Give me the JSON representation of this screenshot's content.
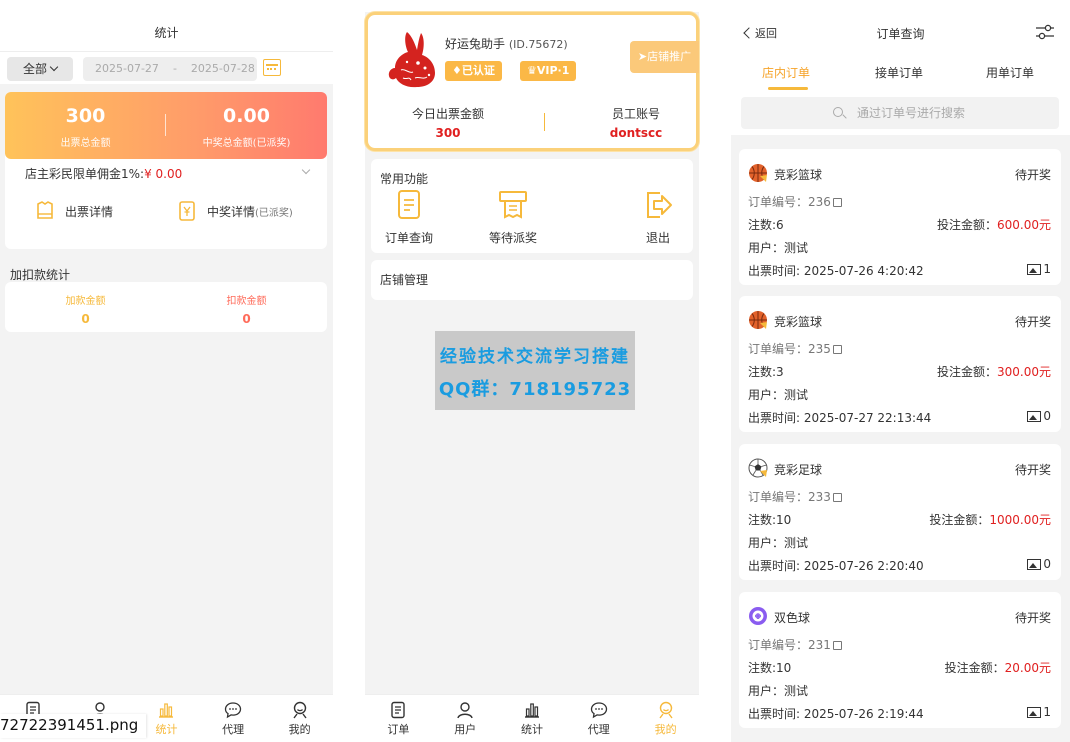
{
  "stats_panel": {
    "header_title": "统计",
    "scope_select": "全部",
    "date_start": "2025-07-27",
    "date_sep": "-",
    "date_end": "2025-07-28",
    "total_issue_value": "300",
    "total_issue_label": "出票总金额",
    "total_win_value": "0.00",
    "total_win_label": "中奖总金额(已派奖)",
    "commission_text": "店主彩民限单佣金1%:",
    "commission_amount": "¥ 0.00",
    "link_issue_detail": "出票详情",
    "link_win_detail": "中奖详情",
    "link_win_detail_sub": "(已派奖)",
    "adjust_section_title": "加扣款统计",
    "add_amount_label": "加款金额",
    "add_amount_value": "0",
    "deduct_amount_label": "扣款金额",
    "deduct_amount_value": "0",
    "tabs": [
      "订单",
      "用户",
      "统计",
      "代理",
      "我的"
    ],
    "active_tab": "统计",
    "accent_color": "#f6b93b"
  },
  "filename_overlay": "72722391451.png",
  "home_panel": {
    "shop_name": "好运兔助手",
    "shop_id": "(ID.75672)",
    "badge_verified": "已认证",
    "badge_vip": "VIP·1",
    "promo_button": "店铺推广",
    "today_issue_label": "今日出票金额",
    "today_issue_value": "300",
    "staff_account_label": "员工账号",
    "staff_account_value": "dontscc",
    "common_functions_title": "常用功能",
    "functions": [
      "订单查询",
      "等待派奖",
      "退出"
    ],
    "shop_manage": "店铺管理",
    "watermark_line1": "经验技术交流学习搭建",
    "watermark_line2": "QQ群：718195723",
    "tabs": [
      "订单",
      "用户",
      "统计",
      "代理",
      "我的"
    ],
    "active_tab": "我的"
  },
  "orders_panel": {
    "back_label": "返回",
    "title": "订单查询",
    "tabs": [
      "店内订单",
      "接单订单",
      "用单订单"
    ],
    "active_tab": "店内订单",
    "search_placeholder": "通过订单号进行搜索",
    "orders": [
      {
        "game": "竞彩篮球",
        "game_icon": "basketball-icon",
        "status": "待开奖",
        "order_no": "订单编号：236",
        "count": "注数:6",
        "bet_label": "投注金额：",
        "bet_amount": "600.00元",
        "user": "用户：测试",
        "time": "出票时间: 2025-07-26 4:20:42",
        "images": "1"
      },
      {
        "game": "竞彩篮球",
        "game_icon": "basketball-icon",
        "status": "待开奖",
        "order_no": "订单编号：235",
        "count": "注数:3",
        "bet_label": "投注金额：",
        "bet_amount": "300.00元",
        "user": "用户：测试",
        "time": "出票时间: 2025-07-27 22:13:44",
        "images": "0"
      },
      {
        "game": "竞彩足球",
        "game_icon": "soccer-icon",
        "status": "待开奖",
        "order_no": "订单编号：233",
        "count": "注数:10",
        "bet_label": "投注金额：",
        "bet_amount": "1000.00元",
        "user": "用户：测试",
        "time": "出票时间: 2025-07-26 2:20:40",
        "images": "0"
      },
      {
        "game": "双色球",
        "game_icon": "lottery-ball-icon",
        "status": "待开奖",
        "order_no": "订单编号：231",
        "count": "注数:10",
        "bet_label": "投注金额：",
        "bet_amount": "20.00元",
        "user": "用户：测试",
        "time": "出票时间: 2025-07-26 2:19:44",
        "images": "1"
      }
    ]
  }
}
